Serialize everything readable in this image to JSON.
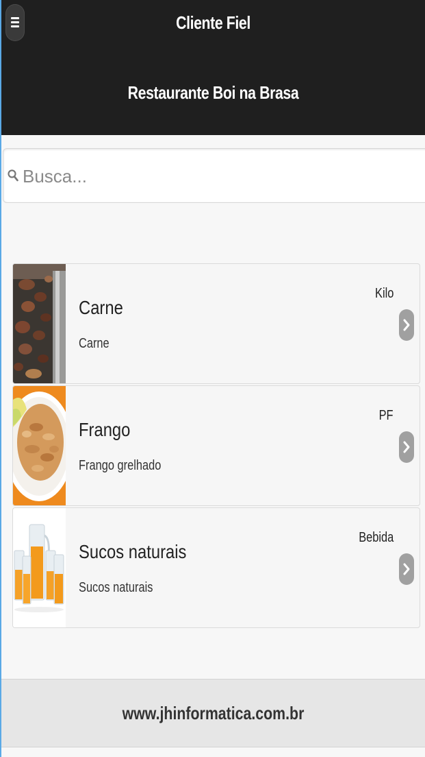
{
  "header": {
    "app_title": "Cliente Fiel",
    "subtitle": "Restaurante Boi na Brasa",
    "menu_icon": "hamburger-menu-icon"
  },
  "search": {
    "placeholder": "Busca...",
    "value": "",
    "icon": "search-icon"
  },
  "items": [
    {
      "title": "Carne",
      "description": "Carne",
      "tag": "Kilo",
      "image": "grilled-meat"
    },
    {
      "title": "Frango",
      "description": "Frango grelhado",
      "tag": "PF",
      "image": "grilled-chicken"
    },
    {
      "title": "Sucos naturais",
      "description": "Sucos naturais",
      "tag": "Bebida",
      "image": "orange-juice"
    }
  ],
  "footer": {
    "text": "www.jhinformatica.com.br"
  },
  "colors": {
    "header_bg": "#1f1f1f",
    "page_bg": "#f7f7f7",
    "footer_bg": "#e6e6e6",
    "chevron_bg": "#a0a0a0"
  }
}
